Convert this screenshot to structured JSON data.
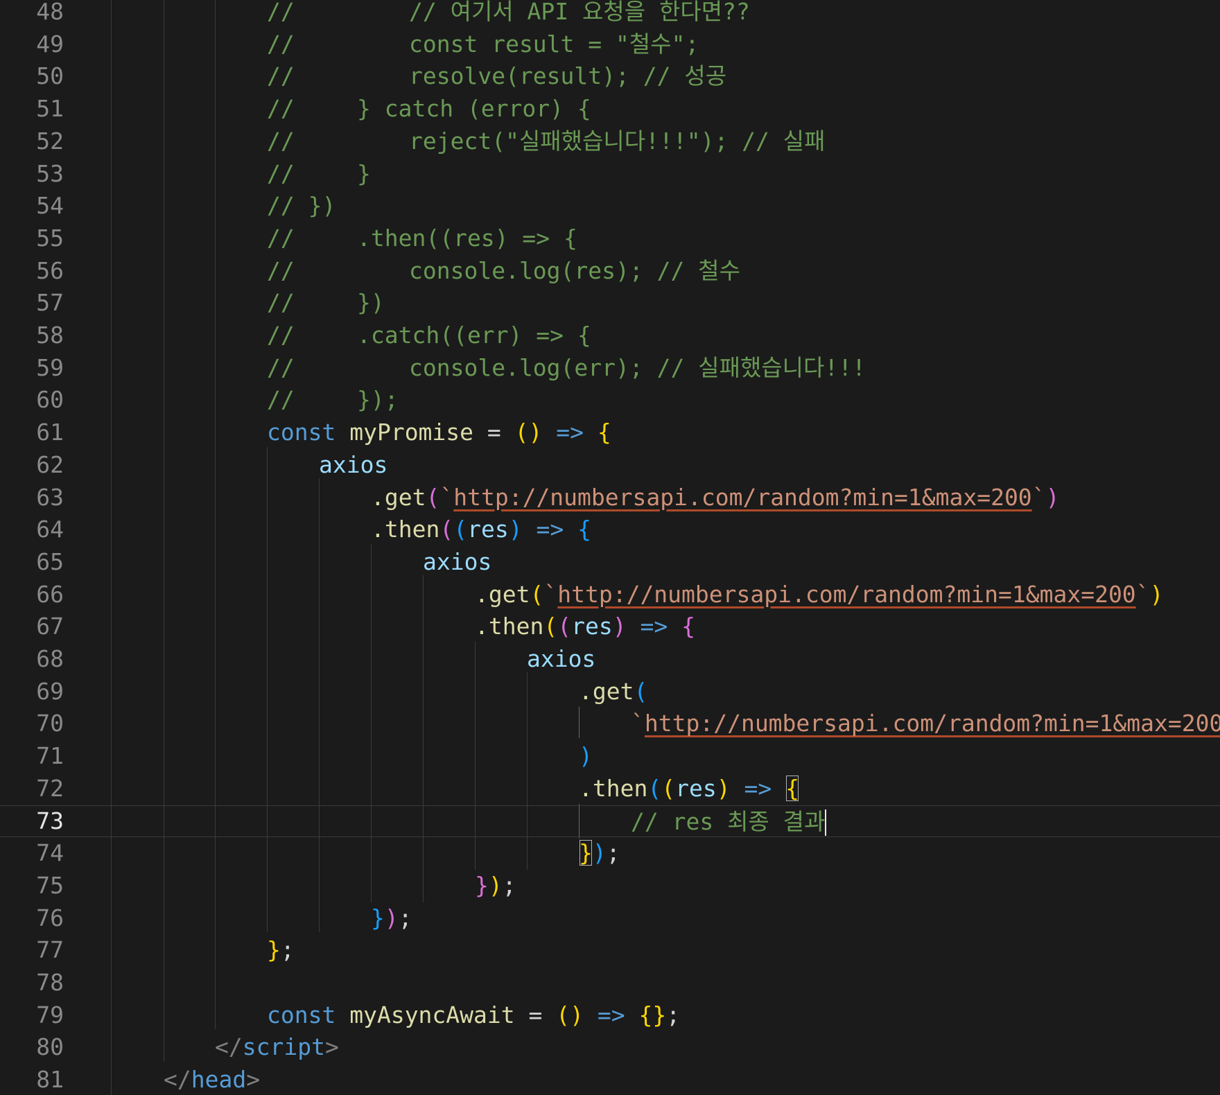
{
  "editor": {
    "active_line": 73,
    "line_numbers": [
      "48",
      "49",
      "50",
      "51",
      "52",
      "53",
      "54",
      "55",
      "56",
      "57",
      "58",
      "59",
      "60",
      "61",
      "62",
      "63",
      "64",
      "65",
      "66",
      "67",
      "68",
      "69",
      "70",
      "71",
      "72",
      "73",
      "74",
      "75",
      "76",
      "77",
      "78",
      "79",
      "80",
      "81"
    ],
    "colors": {
      "background": "#1b1b1b",
      "comment": "#6a9955",
      "keyword": "#569cd6",
      "function": "#dcdcaa",
      "variable": "#9cdcfe",
      "string": "#ce9178",
      "bracket_level_1": "#ffd700",
      "bracket_level_2": "#da70d6",
      "bracket_level_3": "#179fff"
    },
    "tokens": {
      "comment_slashes": "//",
      "c48": "// 여기서 API 요청을 한다면??",
      "c49": "const result = \"철수\";",
      "c50": "resolve(result); // 성공",
      "c51": "} catch (error) {",
      "c52": "reject(\"실패했습니다!!!\"); // 실패",
      "c53": "}",
      "c54": "// })",
      "c55": ".then((res) => {",
      "c56": "console.log(res); // 철수",
      "c57": "})",
      "c58": ".catch((err) => {",
      "c59": "console.log(err); // 실패했습니다!!!",
      "c60": "});",
      "const": "const",
      "myPromise": "myPromise",
      "myAsyncAwait": "myAsyncAwait",
      "eq": "=",
      "arrow": "=>",
      "paren_pair": "()",
      "open_paren": "(",
      "close_paren": ")",
      "open_brace": "{",
      "close_brace": "}",
      "empty_braces": "{}",
      "semicolon": ";",
      "brace_close_semi": "};",
      "paren_close_semi": ");",
      "axios": "axios",
      "dot_get": ".get",
      "dot_then": ".then",
      "res": "res",
      "backtick": "`",
      "url": "http://numbersapi.com/random?min=1&max=200",
      "final_comment": "// res 최종 결과",
      "script_close_open": "</",
      "script_name": "script",
      "head_name": "head",
      "tag_end": ">"
    }
  }
}
